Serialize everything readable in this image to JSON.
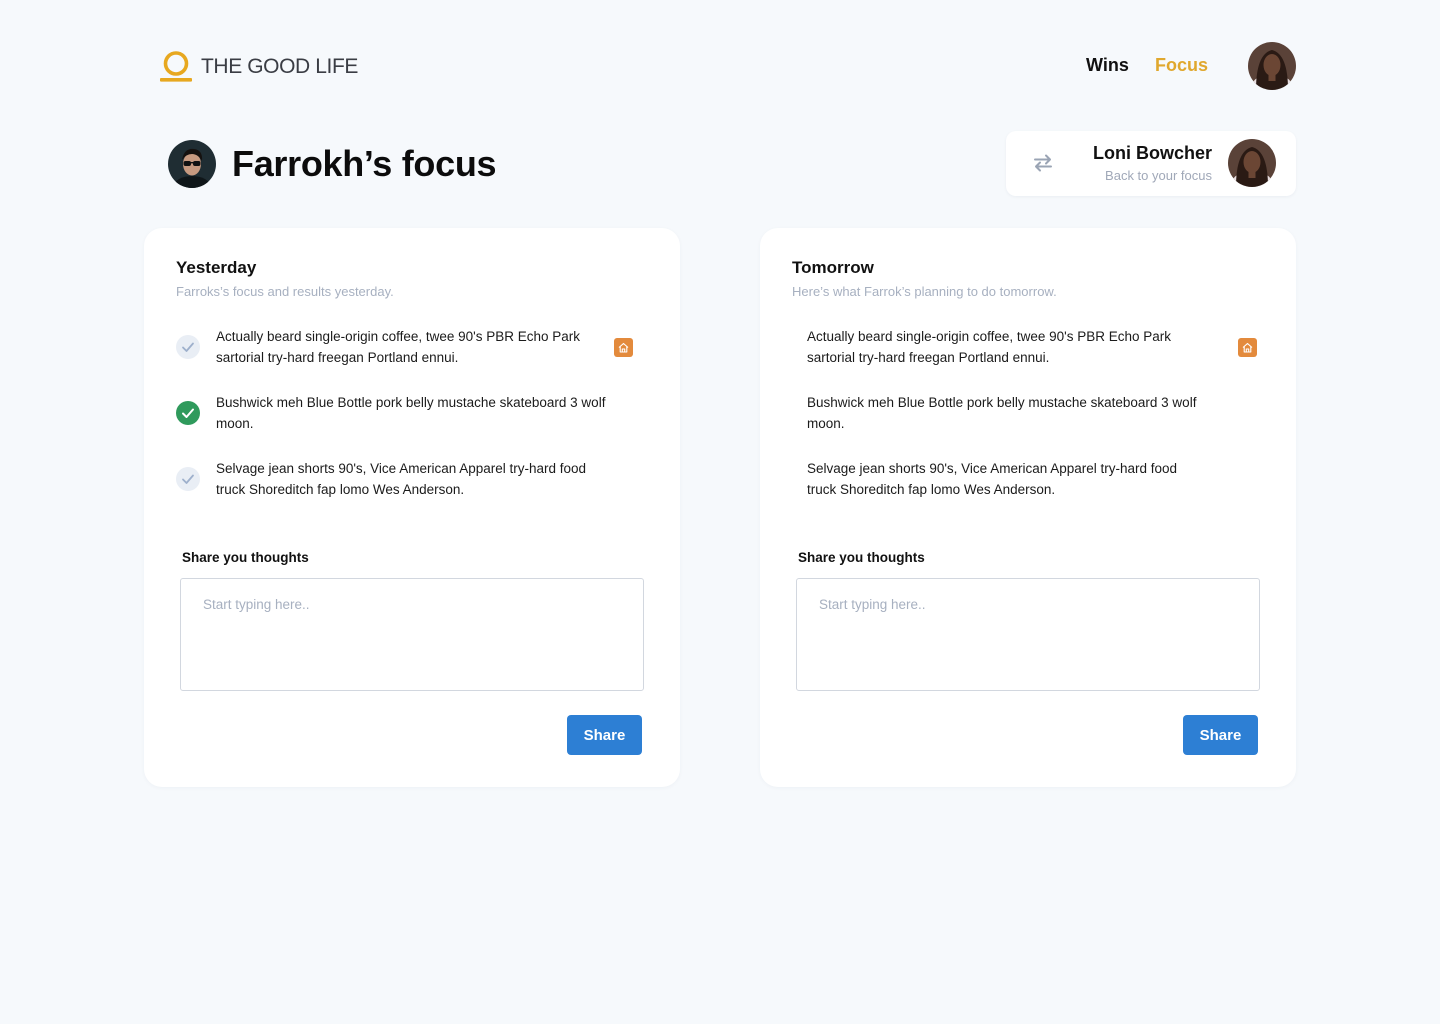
{
  "header": {
    "brand": "THE GOOD LIFE",
    "nav": [
      {
        "label": "Wins",
        "active": false
      },
      {
        "label": "Focus",
        "active": true
      }
    ],
    "accent_color": "#e0a82e"
  },
  "page": {
    "title": "Farrokh’s focus"
  },
  "switch_user": {
    "name": "Loni Bowcher",
    "subtitle": "Back to your focus",
    "icon": "swap-arrows-icon"
  },
  "yesterday": {
    "title": "Yesterday",
    "subtitle": "Farroks’s focus and results yesterday.",
    "items": [
      {
        "text": "Actually beard single-origin coffee, twee 90's PBR Echo Park sartorial try-hard freegan Portland ennui.",
        "done": false,
        "tag": "home-icon"
      },
      {
        "text": "Bushwick meh Blue Bottle pork belly mustache skateboard 3 wolf moon.",
        "done": true,
        "tag": null
      },
      {
        "text": "Selvage jean shorts 90's, Vice American Apparel try-hard food truck Shoreditch fap lomo Wes Anderson.",
        "done": false,
        "tag": null
      }
    ],
    "thoughts_label": "Share you thoughts",
    "thoughts_placeholder": "Start typing here..",
    "share_label": "Share"
  },
  "tomorrow": {
    "title": "Tomorrow",
    "subtitle": "Here’s what Farrok’s planning to do tomorrow.",
    "items": [
      {
        "text": "Actually beard single-origin coffee, twee 90's PBR Echo Park sartorial try-hard freegan Portland ennui.",
        "tag": "home-icon"
      },
      {
        "text": "Bushwick meh Blue Bottle pork belly mustache skateboard 3 wolf moon.",
        "tag": null
      },
      {
        "text": "Selvage jean shorts 90's, Vice American Apparel try-hard food truck Shoreditch fap lomo Wes Anderson.",
        "tag": null
      }
    ],
    "thoughts_label": "Share you thoughts",
    "thoughts_placeholder": "Start typing here..",
    "share_label": "Share"
  },
  "colors": {
    "done": "#2f9a5c",
    "primary_button": "#2d7fd4",
    "tag": "#e38a3c",
    "background": "#f6f9fc"
  }
}
